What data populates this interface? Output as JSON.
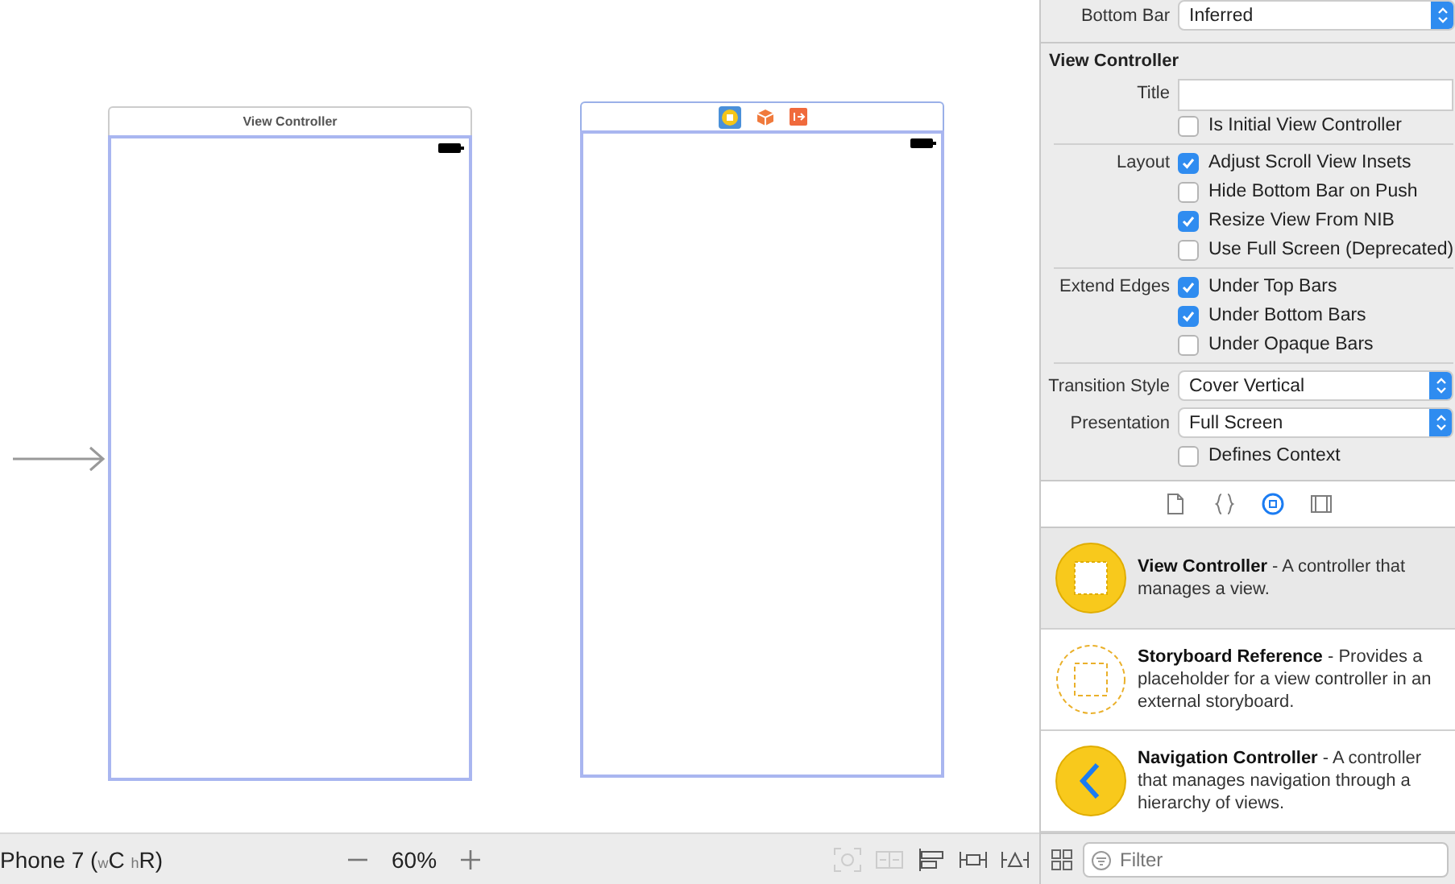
{
  "canvas": {
    "scenes": [
      {
        "kind": "titled",
        "title": "View Controller"
      },
      {
        "kind": "icons",
        "selected": true
      }
    ]
  },
  "bottom_bar": {
    "device": "Phone 7 ($_{w}$C $_{h}$R)",
    "zoom": "60%"
  },
  "inspector": {
    "bottom_bar": {
      "label": "Bottom Bar",
      "value": "Inferred"
    },
    "section": "View Controller",
    "title_field": {
      "label": "Title"
    },
    "groups": [
      {
        "rows": [
          {
            "label": "Is Initial View Controller",
            "checked": false
          }
        ]
      },
      {
        "label": "Layout",
        "rows": [
          {
            "label": "Adjust Scroll View Insets",
            "checked": true
          },
          {
            "label": "Hide Bottom Bar on Push",
            "checked": false
          },
          {
            "label": "Resize View From NIB",
            "checked": true
          },
          {
            "label": "Use Full Screen (Deprecated)",
            "checked": false
          }
        ]
      },
      {
        "label": "Extend Edges",
        "rows": [
          {
            "label": "Under Top Bars",
            "checked": true
          },
          {
            "label": "Under Bottom Bars",
            "checked": true
          },
          {
            "label": "Under Opaque Bars",
            "checked": false
          }
        ]
      }
    ],
    "selects": [
      {
        "label": "Transition Style",
        "value": "Cover Vertical"
      },
      {
        "label": "Presentation",
        "value": "Full Screen"
      }
    ],
    "trailing_rows": [
      {
        "label": "Defines Context",
        "checked": false
      }
    ]
  },
  "library": {
    "tabs": [
      {
        "kind": "file",
        "selected": false
      },
      {
        "kind": "braces",
        "selected": false
      },
      {
        "kind": "object",
        "selected": true
      },
      {
        "kind": "media",
        "selected": false
      }
    ],
    "items": [
      {
        "kind": "view",
        "name": "View Controller",
        "description": "- A controller that manages a view.",
        "selected": true
      },
      {
        "kind": "reference",
        "name": "Storyboard Reference",
        "description": "- Provides a placeholder for a view controller in an external storyboard.",
        "selected": false
      },
      {
        "kind": "navigation",
        "name": "Navigation Controller",
        "description": "- A controller that manages navigation through a hierarchy of views.",
        "selected": false
      }
    ],
    "filter": {
      "placeholder": "Filter"
    }
  }
}
